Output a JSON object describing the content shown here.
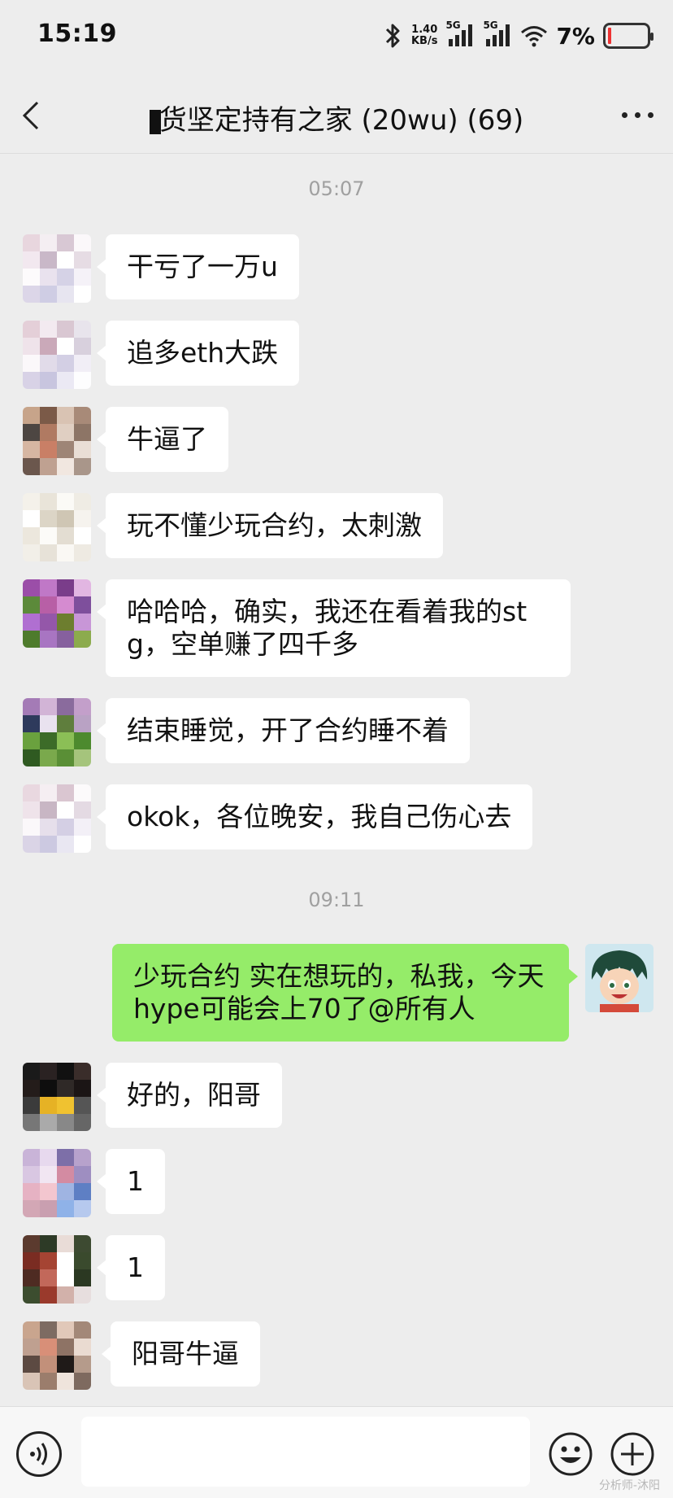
{
  "status_bar": {
    "time": "15:19",
    "net_speed_value": "1.40",
    "net_speed_unit": "KB/s",
    "sim1": "5G",
    "sim2": "5G",
    "battery": "7%"
  },
  "header": {
    "title": "货坚定持有之家 (20wu) (69)"
  },
  "chat": {
    "timestamps": [
      "05:07",
      "09:11"
    ],
    "messages": [
      {
        "side": "in",
        "text": "干亏了一万u"
      },
      {
        "side": "in",
        "text": "追多eth大跌"
      },
      {
        "side": "in",
        "text": "牛逼了"
      },
      {
        "side": "in",
        "text": "玩不懂少玩合约，太刺激"
      },
      {
        "side": "in",
        "text": "哈哈哈，确实，我还在看着我的stg，空单赚了四千多"
      },
      {
        "side": "in",
        "text": "结束睡觉，开了合约睡不着"
      },
      {
        "side": "in",
        "text": "okok，各位晚安，我自己伤心去"
      },
      {
        "side": "out",
        "text": "少玩合约 实在想玩的，私我，今天hype可能会上70了@所有人"
      },
      {
        "side": "in",
        "text": "好的，阳哥"
      },
      {
        "side": "in",
        "text": "1"
      },
      {
        "side": "in",
        "text": "1"
      },
      {
        "side": "in",
        "text": "阳哥牛逼"
      }
    ]
  },
  "input_bar": {
    "voice_icon": "voice-icon",
    "emoji_icon": "emoji-icon",
    "plus_icon": "plus-icon"
  },
  "watermark": "分析师-沐阳",
  "colors": {
    "background": "#ededed",
    "incoming_bubble": "#ffffff",
    "outgoing_bubble": "#95ec69"
  }
}
